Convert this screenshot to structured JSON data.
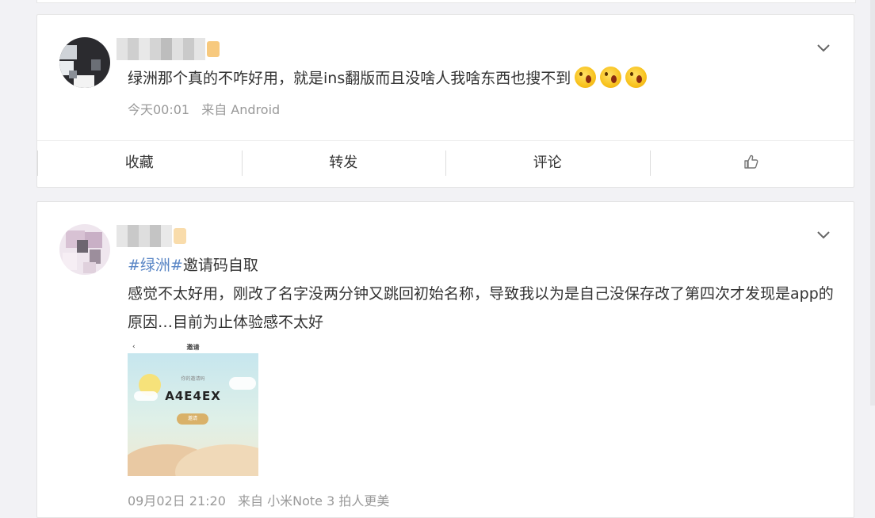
{
  "posts": [
    {
      "text": "绿洲那个真的不咋好用，就是ins翻版而且没啥人我啥东西也搜不到",
      "time": "今天00:01",
      "source": "来自 Android",
      "actions": {
        "collect": "收藏",
        "repost": "转发",
        "comment": "评论"
      }
    },
    {
      "topic": "#绿洲#",
      "title_rest": "邀请码自取",
      "text": "感觉不太好用，刚改了名字没两分钟又跳回初始名称，导致我以为是自己没保存改了第四次才发现是app的原因…目前为止体验感不太好",
      "image": {
        "back": "‹",
        "title": "邀请",
        "subtitle": "你的邀请码",
        "code": "A4E4EX",
        "button": "邀请"
      },
      "time": "09月02日 21:20",
      "source": "来自 小米Note 3 拍人更美"
    }
  ],
  "icons": {
    "expand": "chevron-down-icon",
    "like": "thumbs-up-icon",
    "emoji": "screaming-face-emoji"
  },
  "colors": {
    "topic": "#5b87c6",
    "meta": "#999999",
    "background": "#f2f2f5"
  }
}
